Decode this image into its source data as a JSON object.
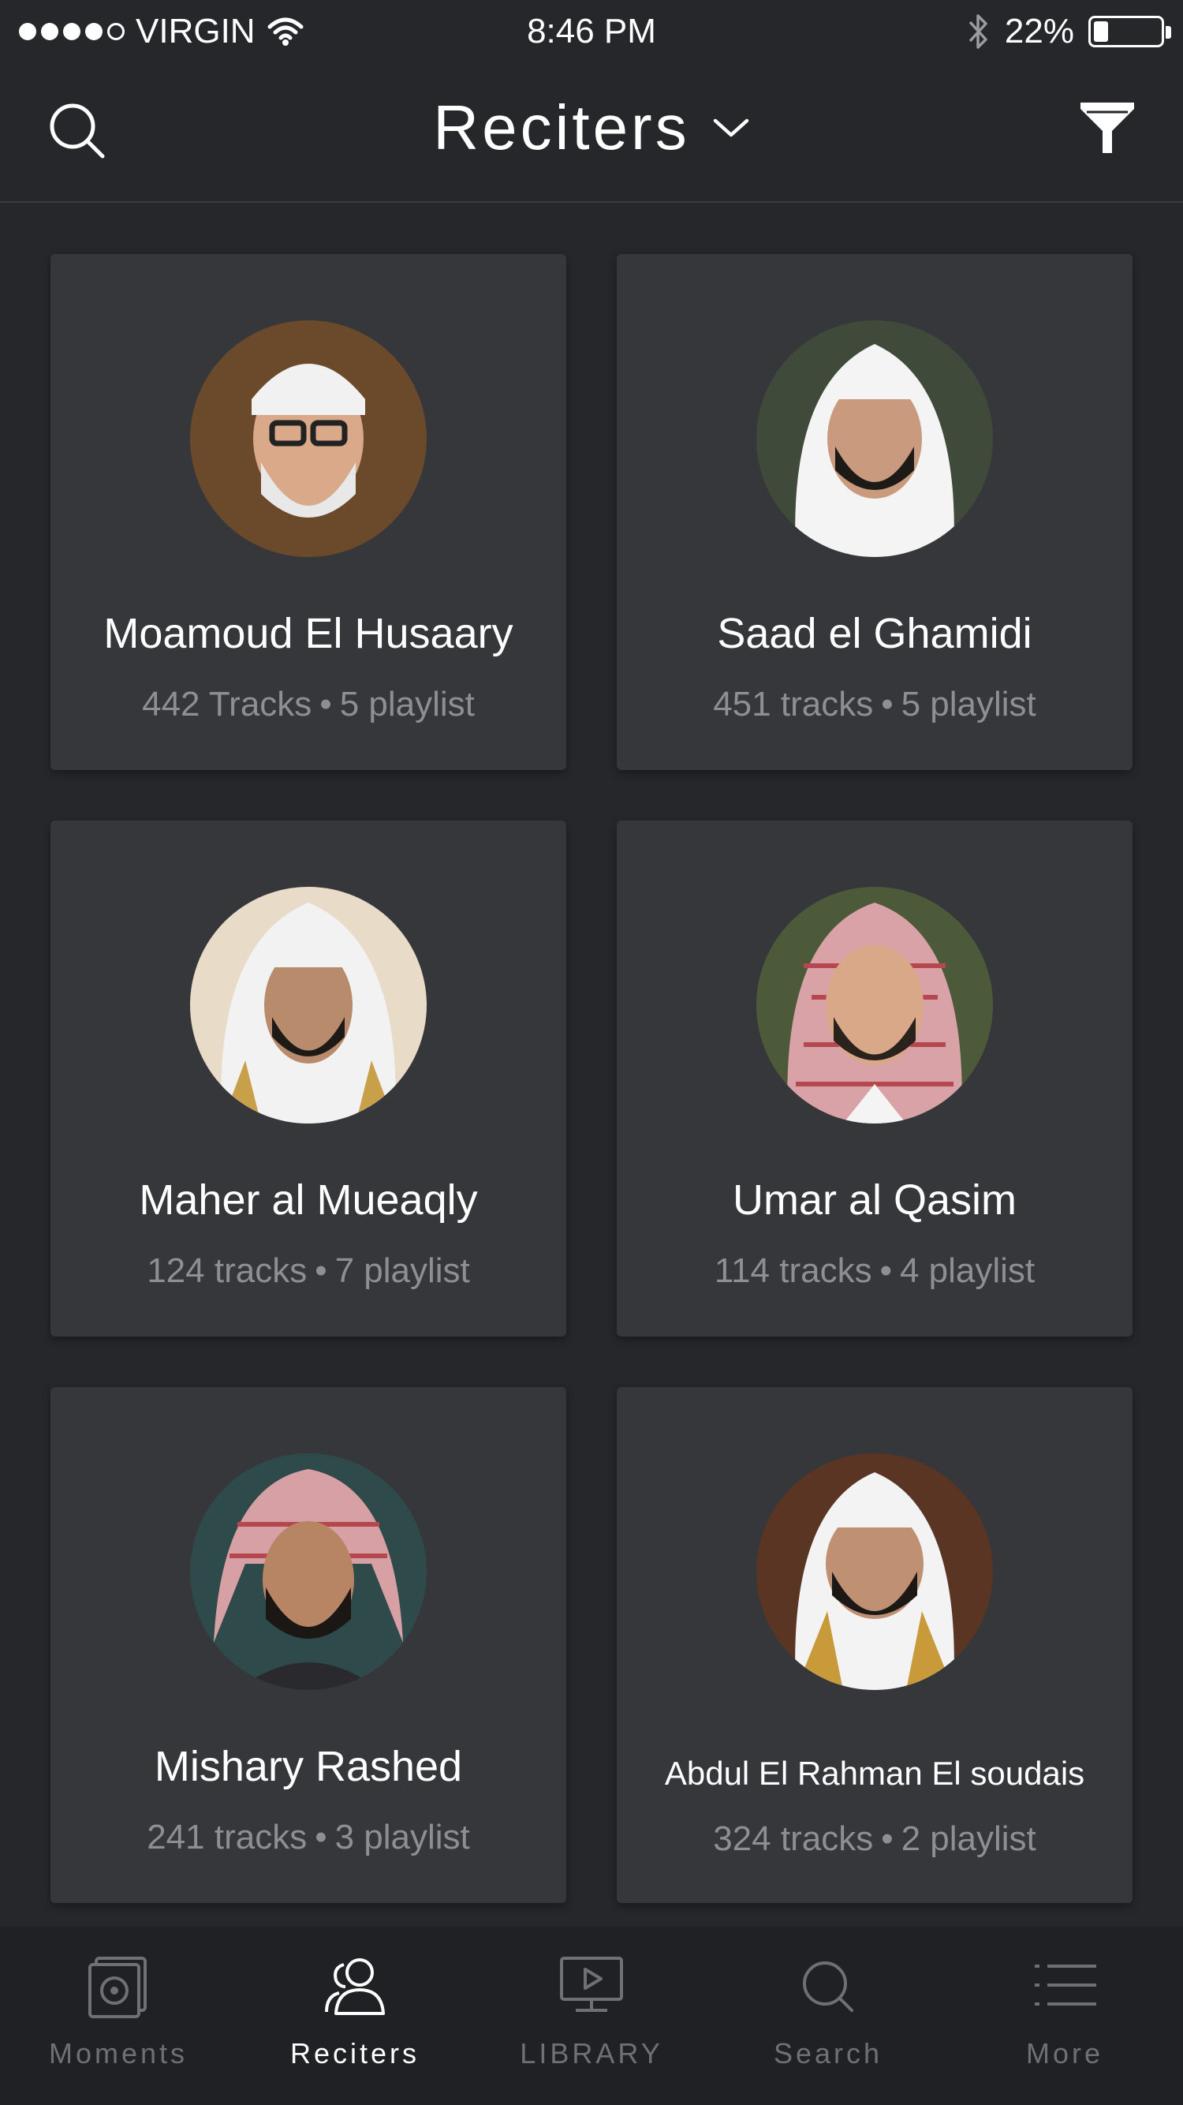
{
  "status_bar": {
    "carrier": "VIRGIN",
    "time": "8:46 PM",
    "battery": "22%",
    "battery_level": 0.22,
    "signal_dots_filled": 4,
    "signal_dots_total": 5
  },
  "header": {
    "title": "Reciters"
  },
  "reciters": [
    {
      "name": "Moamoud El Husaary",
      "tracks": "442 Tracks",
      "playlists": "5 playlist",
      "avatar_bg": "#6b4a2c",
      "avatar_face": "#d9a98a"
    },
    {
      "name": "Saad el Ghamidi",
      "tracks": "451 tracks",
      "playlists": "5 playlist",
      "avatar_bg": "#3f4a3a",
      "avatar_face": "#c99a7e"
    },
    {
      "name": "Maher al Mueaqly",
      "tracks": "124 tracks",
      "playlists": "7 playlist",
      "avatar_bg": "#e8dcc8",
      "avatar_face": "#b78b6c"
    },
    {
      "name": "Umar al Qasim",
      "tracks": "114 tracks",
      "playlists": "4 playlist",
      "avatar_bg": "#4d5a3a",
      "avatar_face": "#d8a888"
    },
    {
      "name": "Mishary Rashed",
      "tracks": "241 tracks",
      "playlists": "3 playlist",
      "avatar_bg": "#2f4a4a",
      "avatar_face": "#b88564"
    },
    {
      "name": "Abdul El Rahman El soudais",
      "tracks": "324 tracks",
      "playlists": "2 playlist",
      "avatar_bg": "#5a3524",
      "avatar_face": "#c09072"
    }
  ],
  "separator": "•",
  "tabs": [
    {
      "label": "Moments",
      "icon": "moments-icon",
      "active": false
    },
    {
      "label": "Reciters",
      "icon": "reciters-icon",
      "active": true
    },
    {
      "label": "LIBRARY",
      "icon": "library-icon",
      "active": false
    },
    {
      "label": "Search",
      "icon": "search-icon",
      "active": false
    },
    {
      "label": "More",
      "icon": "more-icon",
      "active": false
    }
  ],
  "colors": {
    "background": "#26272b",
    "card": "#36373b",
    "tabbar": "#202124",
    "muted_text": "#8e8f94",
    "inactive_tab": "#6f7075"
  }
}
